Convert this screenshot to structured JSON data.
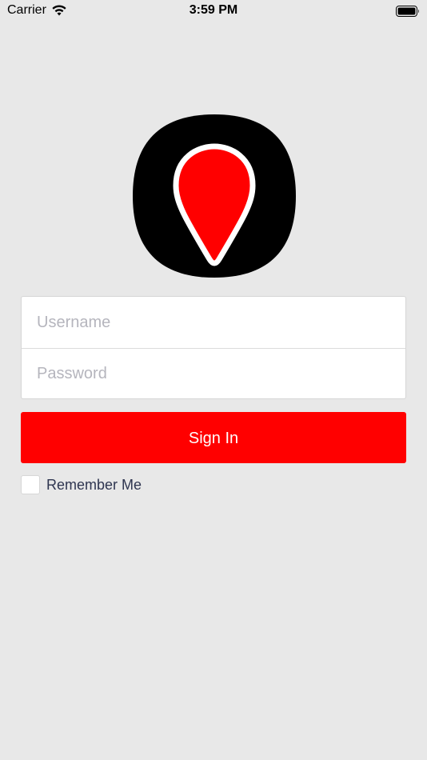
{
  "status_bar": {
    "carrier": "Carrier",
    "time": "3:59 PM"
  },
  "login": {
    "username_placeholder": "Username",
    "password_placeholder": "Password",
    "sign_in_label": "Sign In",
    "remember_label": "Remember Me"
  },
  "colors": {
    "background": "#e8e8e8",
    "accent": "#ff0000",
    "logo_dark": "#000000"
  },
  "icons": {
    "wifi": "wifi-icon",
    "battery": "battery-icon",
    "logo": "map-pin-logo-icon"
  }
}
